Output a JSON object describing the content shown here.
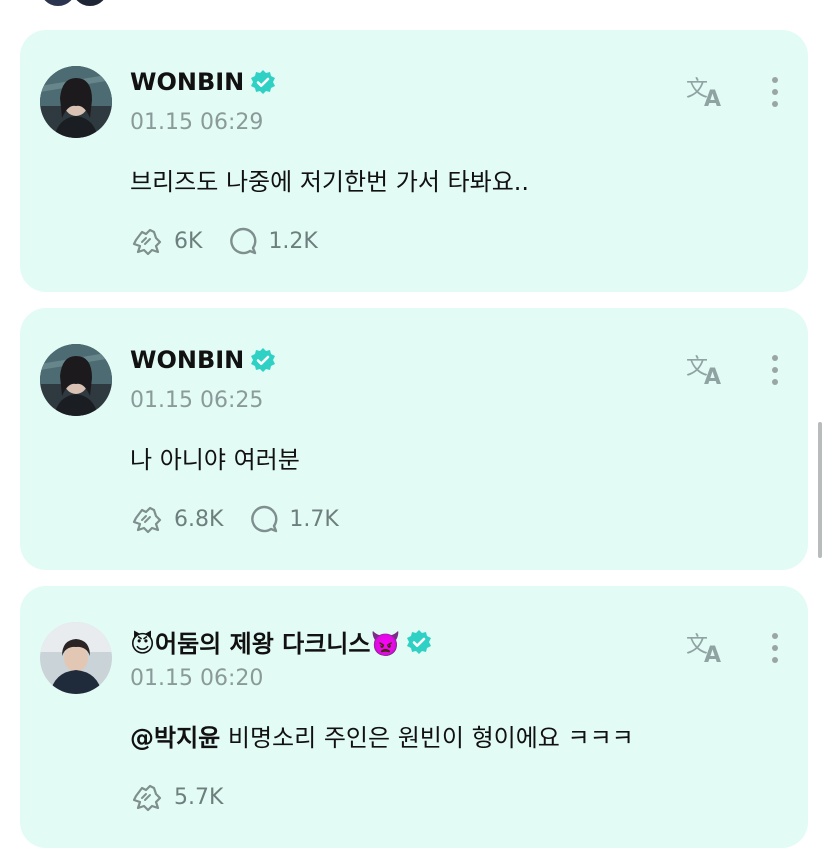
{
  "accent_color": "#e3fbf5",
  "verified_color": "#2fd1c4",
  "posts": [
    {
      "author": "WONBIN",
      "verified": true,
      "timestamp": "01.15 06:29",
      "text": "브리즈도 나중에 저기한번 가서 타봐요..",
      "stats": {
        "reactions": "6K",
        "comments": "1.2K"
      }
    },
    {
      "author": "WONBIN",
      "verified": true,
      "timestamp": "01.15 06:25",
      "text": "나 아니야 여러분",
      "stats": {
        "reactions": "6.8K",
        "comments": "1.7K"
      }
    },
    {
      "author": "😈어둠의 제왕 다크니스👿",
      "verified": true,
      "timestamp": "01.15 06:20",
      "mention": "@박지윤",
      "text": " 비명소리 주인은 원빈이 형이에요 ㅋㅋㅋ",
      "stats": {
        "reactions": "5.7K"
      }
    }
  ],
  "icons": {
    "translate": "translate-icon",
    "more": "more-options-icon",
    "reaction": "reaction-icon",
    "comment": "comment-icon",
    "verified": "verified-badge-icon"
  }
}
